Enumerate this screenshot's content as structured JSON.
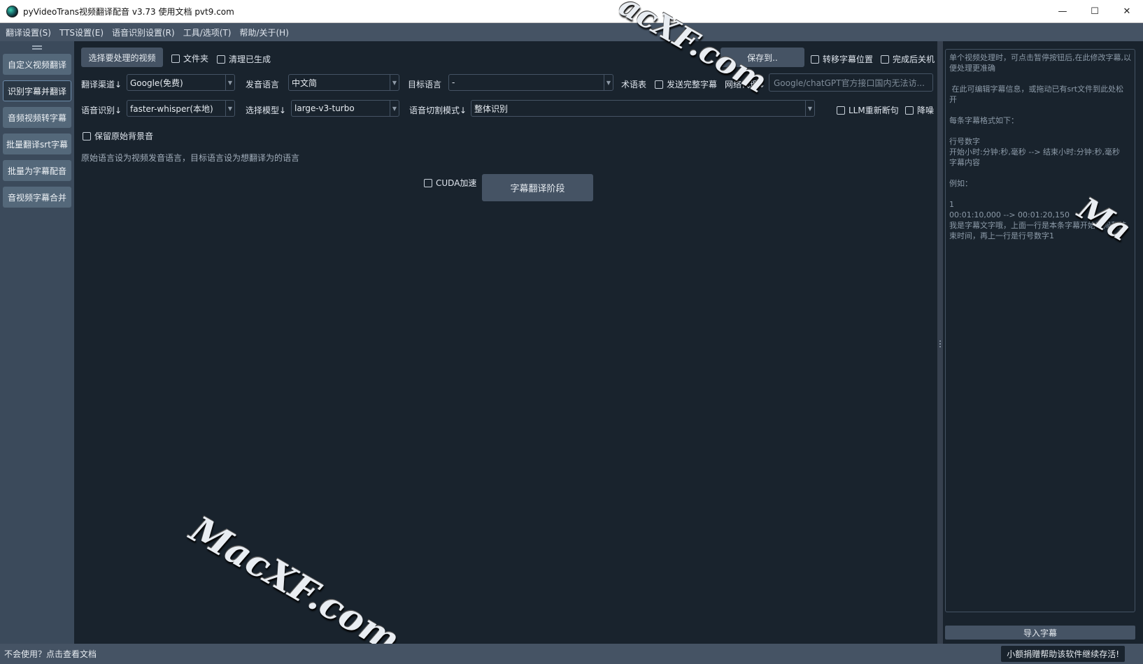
{
  "window": {
    "title": "pyVideoTrans视频翻译配音 v3.73  使用文档  pvt9.com",
    "minimize": "—",
    "maximize": "☐",
    "close": "✕"
  },
  "menu": [
    "翻译设置(S)",
    "TTS设置(E)",
    "语音识别设置(R)",
    "工具/选项(T)",
    "帮助/关于(H)"
  ],
  "sidebar": {
    "items": [
      {
        "label": "自定义视频翻译",
        "active": false
      },
      {
        "label": "识别字幕并翻译",
        "active": true
      },
      {
        "label": "音频视频转字幕",
        "active": false
      },
      {
        "label": "批量翻译srt字幕",
        "active": false
      },
      {
        "label": "批量为字幕配音",
        "active": false
      },
      {
        "label": "音视频字幕合并",
        "active": false
      }
    ]
  },
  "toolbar": {
    "select_video": "选择要处理的视频",
    "folder": "文件夹",
    "clear_generated": "清理已生成",
    "save_to": "保存到..",
    "move_subtitle_pos": "转移字幕位置",
    "shutdown_after": "完成后关机"
  },
  "row1": {
    "translate_channel_label": "翻译渠道↓",
    "translate_channel_value": "Google(免费)",
    "source_lang_label": "发音语言",
    "source_lang_value": "中文简",
    "target_lang_label": "目标语言",
    "target_lang_value": "-",
    "glossary_label": "术语表",
    "send_full_subtitle": "发送完整字幕",
    "proxy_label": "网络代理↓",
    "proxy_placeholder": "Google/chatGPT官方接口国内无法访..."
  },
  "row2": {
    "asr_label": "语音识别↓",
    "asr_value": "faster-whisper(本地)",
    "model_label": "选择模型↓",
    "model_value": "large-v3-turbo",
    "split_label": "语音切割模式↓",
    "split_value": "整体识别",
    "llm_resegment": "LLM重新断句",
    "denoise": "降噪"
  },
  "keep_bg": "保留原始背景音",
  "hint": "原始语言设为视频发音语言，目标语言设为想翻译为的语言",
  "cuda": "CUDA加速",
  "stage_button": "字幕翻译阶段",
  "right": {
    "subtitle_text": "单个视频处理时，可点击暂停按钮后,在此修改字幕,以便处理更准确\n\n 在此可编辑字幕信息，或拖动已有srt文件到此处松开\n\n每条字幕格式如下：\n\n行号数字\n开始小时:分钟:秒,毫秒 --> 结束小时:分钟:秒,毫秒\n字幕内容\n\n例如：\n\n1\n00:01:10,000 --> 00:01:20,150\n我是字幕文字哦，上面一行是本条字幕开始时间和结束时间，再上一行是行号数字1",
    "import_button": "导入字幕"
  },
  "status": {
    "left": "不会使用？点击查看文档",
    "right": "小额捐赠帮助该软件继续存活!"
  },
  "watermarks": [
    "MacXF.com",
    "MacXF.com",
    "Ma",
    "acXF.com"
  ]
}
